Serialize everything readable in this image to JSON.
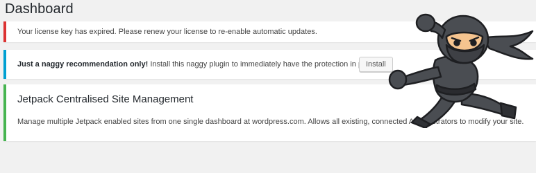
{
  "page": {
    "title": "Dashboard"
  },
  "notices": {
    "license": {
      "text": "Your license key has expired. Please renew your license to re-enable automatic updates."
    },
    "naggy": {
      "strong": "Just a naggy recommendation only!",
      "text": " Install this naggy plugin to immediately have the protection in place.",
      "button": "Install"
    },
    "jetpack": {
      "title": "Jetpack Centralised Site Management",
      "description": "Manage multiple Jetpack enabled sites from one single dashboard at wordpress.com. Allows all existing, connected Administrators to modify your site."
    }
  },
  "colors": {
    "error": "#dc3232",
    "info": "#00a0d2",
    "success": "#46b450",
    "ninja_suit": "#4a4d52",
    "ninja_skin": "#f5c48f"
  },
  "illustration": {
    "icon": "ninja-mascot"
  }
}
